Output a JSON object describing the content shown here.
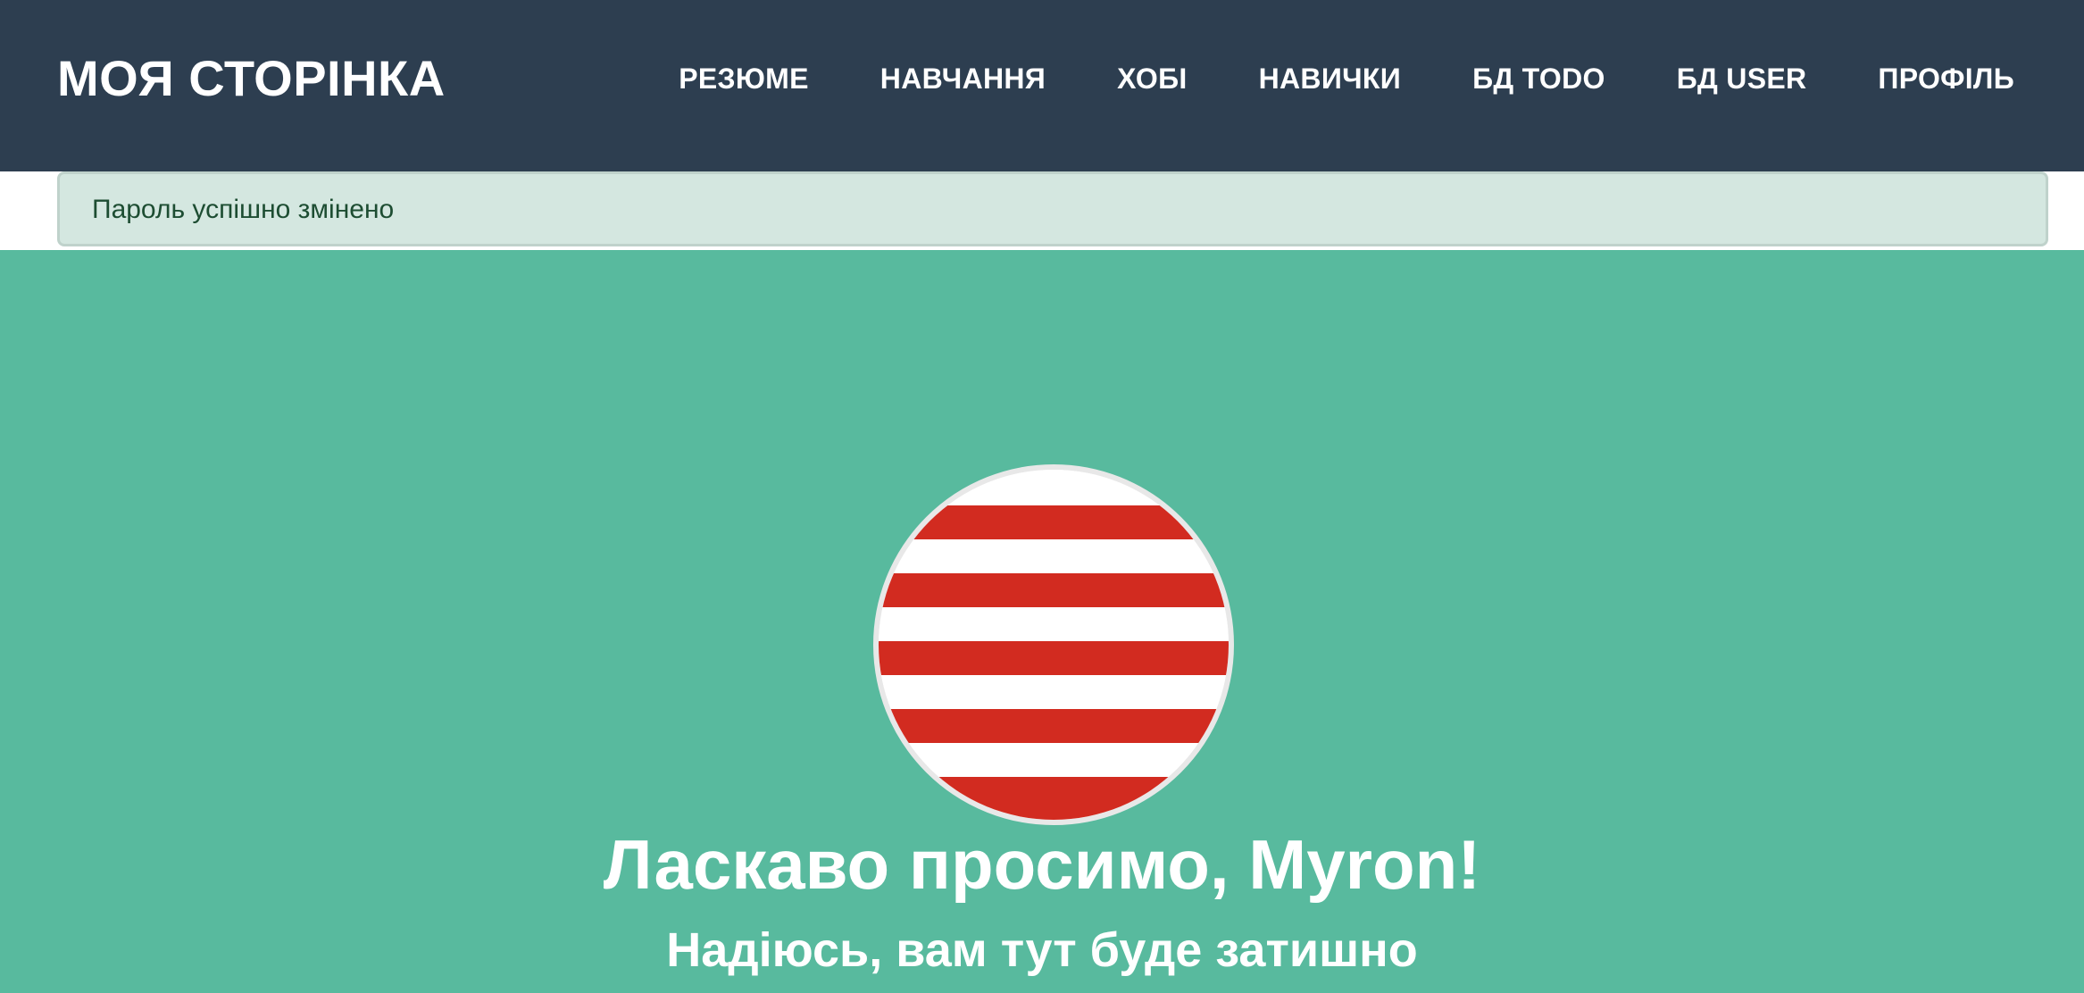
{
  "navbar": {
    "brand": "МОЯ СТОРІНКА",
    "links": [
      {
        "label": "РЕЗЮМЕ"
      },
      {
        "label": "НАВЧАННЯ"
      },
      {
        "label": "ХОБІ"
      },
      {
        "label": "НАВИЧКИ"
      },
      {
        "label": "БД TODO"
      },
      {
        "label": "БД USER"
      },
      {
        "label": "ПРОФІЛЬ"
      }
    ],
    "background_color": "#2d3e50"
  },
  "alert": {
    "message": "Пароль успішно змінено",
    "background_color": "#d4e7e0",
    "text_color": "#1d4d32"
  },
  "masthead": {
    "background_color": "#58ba9e",
    "avatar": {
      "icon": "red-white-striped-circle-avatar",
      "stripe_color": "#d22b20"
    },
    "welcome": "Ласкаво просимо, Myron!",
    "subtitle": "Надіюсь, вам тут буде затишно"
  }
}
